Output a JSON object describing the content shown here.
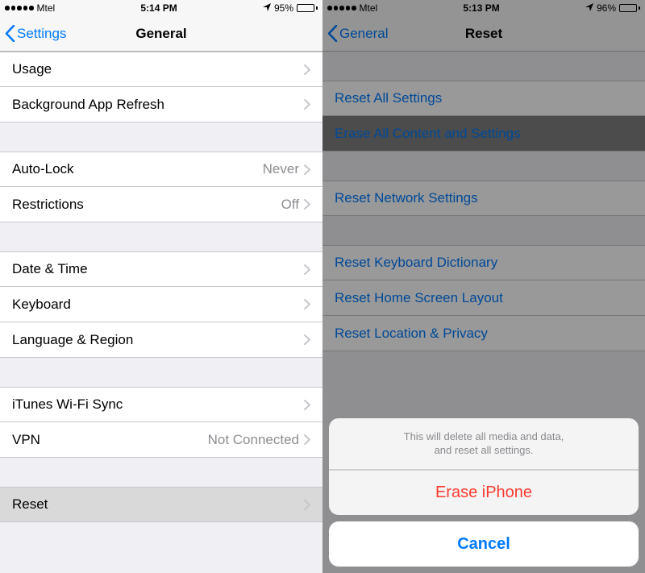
{
  "left": {
    "status": {
      "carrier": "Mtel",
      "time": "5:14 PM",
      "battery_pct": "95%",
      "battery_fill": 95
    },
    "nav": {
      "back": "Settings",
      "title": "General"
    },
    "groups": [
      [
        {
          "label": "Usage",
          "detail": ""
        },
        {
          "label": "Background App Refresh",
          "detail": ""
        }
      ],
      [
        {
          "label": "Auto-Lock",
          "detail": "Never"
        },
        {
          "label": "Restrictions",
          "detail": "Off"
        }
      ],
      [
        {
          "label": "Date & Time",
          "detail": ""
        },
        {
          "label": "Keyboard",
          "detail": ""
        },
        {
          "label": "Language & Region",
          "detail": ""
        }
      ],
      [
        {
          "label": "iTunes Wi-Fi Sync",
          "detail": ""
        },
        {
          "label": "VPN",
          "detail": "Not Connected"
        }
      ],
      [
        {
          "label": "Reset",
          "detail": ""
        }
      ]
    ]
  },
  "right": {
    "status": {
      "carrier": "Mtel",
      "time": "5:13 PM",
      "battery_pct": "96%",
      "battery_fill": 96
    },
    "nav": {
      "back": "General",
      "title": "Reset"
    },
    "groups": [
      [
        {
          "label": "Reset All Settings"
        },
        {
          "label": "Erase All Content and Settings"
        }
      ],
      [
        {
          "label": "Reset Network Settings"
        }
      ],
      [
        {
          "label": "Reset Keyboard Dictionary"
        },
        {
          "label": "Reset Home Screen Layout"
        },
        {
          "label": "Reset Location & Privacy"
        }
      ]
    ],
    "sheet": {
      "message_line1": "This will delete all media and data,",
      "message_line2": "and reset all settings.",
      "destructive": "Erase iPhone",
      "cancel": "Cancel"
    }
  }
}
